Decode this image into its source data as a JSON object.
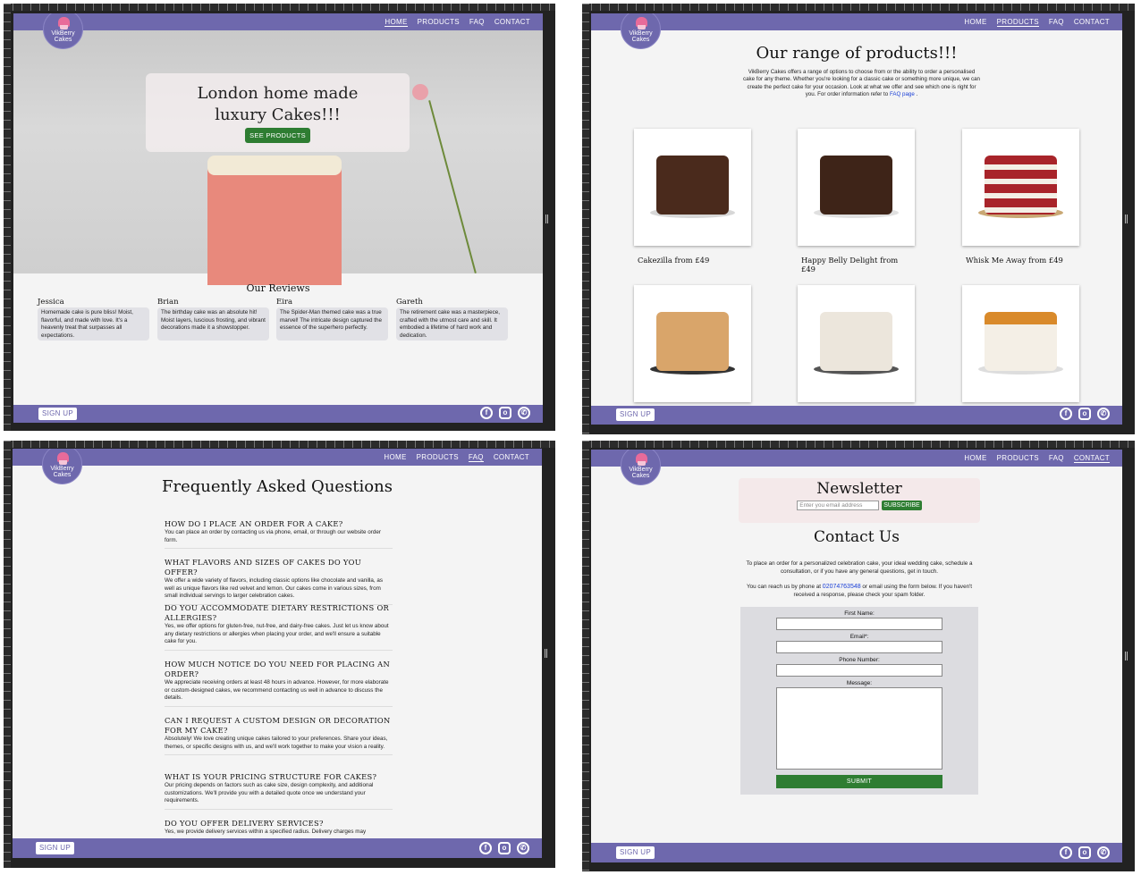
{
  "nav": {
    "home": "HOME",
    "products": "PRODUCTS",
    "faq": "FAQ",
    "contact": "CONTACT"
  },
  "logo": {
    "line1": "VikBerry",
    "line2": "Cakes"
  },
  "footer": {
    "signup": "SIGN UP",
    "icons": [
      "facebook-icon",
      "instagram-icon",
      "whatsapp-icon"
    ]
  },
  "colors": {
    "brand": "#6e68ad",
    "green": "#2e7d32",
    "link": "#1a3fd6"
  },
  "home": {
    "hero_title": "London home made luxury Cakes!!!",
    "hero_button": "SEE PRODUCTS",
    "reviews_title": "Our Reviews",
    "reviews": [
      {
        "name": "Jessica",
        "text": "Homemade cake is pure bliss! Moist, flavorful, and made with love. It's a heavenly treat that surpasses all expectations."
      },
      {
        "name": "Brian",
        "text": "The birthday cake was an absolute hit! Moist layers, luscious frosting, and vibrant decorations made it a showstopper."
      },
      {
        "name": "Eira",
        "text": "The Spider-Man themed cake was a true marvel! The intricate design captured the essence of the superhero perfectly."
      },
      {
        "name": "Gareth",
        "text": "The retirement cake was a masterpiece, crafted with the utmost care and skill. It embodied a lifetime of hard work and dedication."
      }
    ]
  },
  "products": {
    "title": "Our range of products!!!",
    "desc": "VikBerry Cakes offers a range of options to choose from or the ability to order a personalised cake for any theme. Whether you're looking for a classic cake or something more unique, we can create the perfect cake for your occasion. Look at what we offer and see which one is right for you. For order information refer to",
    "faq_link": "FAQ page",
    "items": [
      {
        "name": "Cakezilla from £49"
      },
      {
        "name": "Happy Belly Delight from £49"
      },
      {
        "name": "Whisk Me Away from £49"
      }
    ]
  },
  "faq": {
    "title": "Frequently Asked Questions",
    "items": [
      {
        "q": "HOW DO I PLACE AN ORDER FOR A CAKE?",
        "a": "You can place an order by contacting us via phone, email, or through our website order form."
      },
      {
        "q": "WHAT FLAVORS AND SIZES OF CAKES DO YOU OFFER?",
        "a": "We offer a wide variety of flavors, including classic options like chocolate and vanilla, as well as unique flavors like red velvet and lemon. Our cakes come in various sizes, from small individual servings to larger celebration cakes."
      },
      {
        "q": "DO YOU ACCOMMODATE DIETARY RESTRICTIONS OR ALLERGIES?",
        "a": "Yes, we offer options for gluten-free, nut-free, and dairy-free cakes. Just let us know about any dietary restrictions or allergies when placing your order, and we'll ensure a suitable cake for you."
      },
      {
        "q": "HOW MUCH NOTICE DO YOU NEED FOR PLACING AN ORDER?",
        "a": "We appreciate receiving orders at least 48 hours in advance. However, for more elaborate or custom-designed cakes, we recommend contacting us well in advance to discuss the details."
      },
      {
        "q": "CAN I REQUEST A CUSTOM DESIGN OR DECORATION FOR MY CAKE?",
        "a": "Absolutely! We love creating unique cakes tailored to your preferences. Share your ideas, themes, or specific designs with us, and we'll work together to make your vision a reality."
      },
      {
        "q": "WHAT IS YOUR PRICING STRUCTURE FOR CAKES?",
        "a": "Our pricing depends on factors such as cake size, design complexity, and additional customizations. We'll provide you with a detailed quote once we understand your requirements."
      },
      {
        "q": "DO YOU OFFER DELIVERY SERVICES?",
        "a": "Yes, we provide delivery services within a specified radius. Delivery charges may"
      }
    ]
  },
  "contact": {
    "newsletter_title": "Newsletter",
    "email_placeholder": "Enter you email address",
    "subscribe": "SUBSCRIBE",
    "title": "Contact Us",
    "p1": "To place an order for a personalized celebration cake, your ideal wedding cake, schedule a consultation, or if you have any general questions, get in touch.",
    "p2a": "You can reach us by phone at",
    "phone": "02074763548",
    "p2b": "or email using the form below. If you haven't received a response, please check your spam folder.",
    "first_name": "First Name:",
    "email": "Email*:",
    "phone_label": "Phone Number:",
    "message": "Message:",
    "submit": "SUBMIT"
  }
}
